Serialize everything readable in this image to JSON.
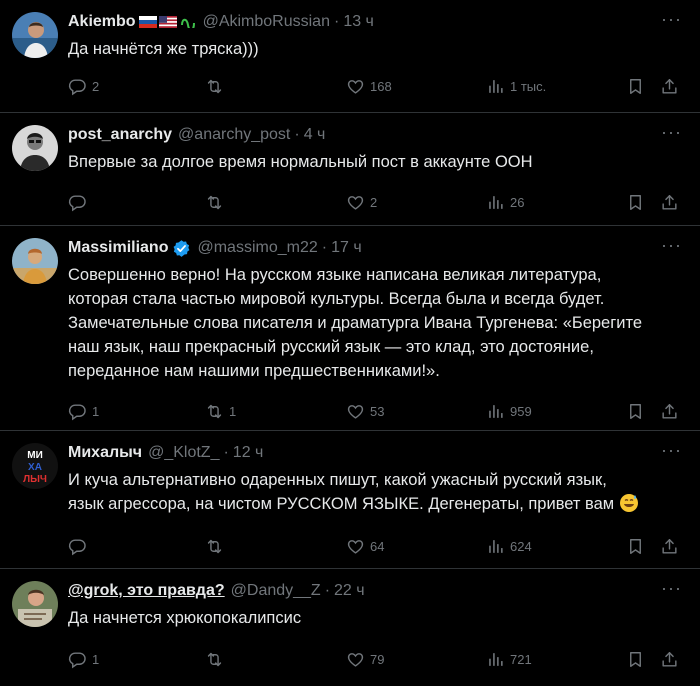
{
  "posts": [
    {
      "name": "Akiembo",
      "handle": "@AkimboRussian",
      "time": "13 ч",
      "text": "Да начнётся же тряска)))",
      "reply_count": "2",
      "repost_count": "",
      "like_count": "168",
      "view_count": "1 тыс."
    },
    {
      "name": "post_anarchy",
      "handle": "@anarchy_post",
      "time": "4 ч",
      "text": "Впервые за долгое время нормальный пост в аккаунте ООН",
      "reply_count": "",
      "repost_count": "",
      "like_count": "2",
      "view_count": "26"
    },
    {
      "name": "Massimiliano",
      "handle": "@massimo_m22",
      "time": "17 ч",
      "text_lines": [
        "Совершенно верно! На русском языке написана великая литература,",
        "которая стала  частью мировой культуры. Всегда была и всегда будет.",
        "Замечательные слова писателя и драматурга Ивана Тургенева: «Берегите",
        "наш язык, наш прекрасный русский язык — это клад, это достояние,",
        "переданное нам нашими предшественниками!»."
      ],
      "reply_count": "1",
      "repost_count": "1",
      "like_count": "53",
      "view_count": "959"
    },
    {
      "name": "Михалыч",
      "handle": "@_KlotZ_",
      "time": "12 ч",
      "avatar_text": "МИ ХА ЛЫЧ",
      "text_lines": [
        "И куча альтернативно одаренных пишут, какой ужасный русский язык,",
        "язык агрессора, на чистом РУССКОМ ЯЗЫКЕ. Дегенераты, привет вам"
      ],
      "reply_count": "",
      "repost_count": "",
      "like_count": "64",
      "view_count": "624"
    },
    {
      "name": "@grok, это правда?",
      "handle": "@Dandy__Z",
      "time": "22 ч",
      "text": "Да начнется хрюкопокалипсис",
      "reply_count": "1",
      "repost_count": "",
      "like_count": "79",
      "view_count": "721"
    }
  ],
  "separator": "·",
  "menu_glyph": "···",
  "colors": {
    "background": "#000000",
    "text": "#e7e9ea",
    "muted": "#71767b",
    "verified": "#1d9bf0",
    "divider": "#2f3336"
  },
  "icons": [
    "reply-icon",
    "repost-icon",
    "like-icon",
    "views-icon",
    "bookmark-icon",
    "share-icon",
    "verified-icon",
    "more-icon"
  ]
}
